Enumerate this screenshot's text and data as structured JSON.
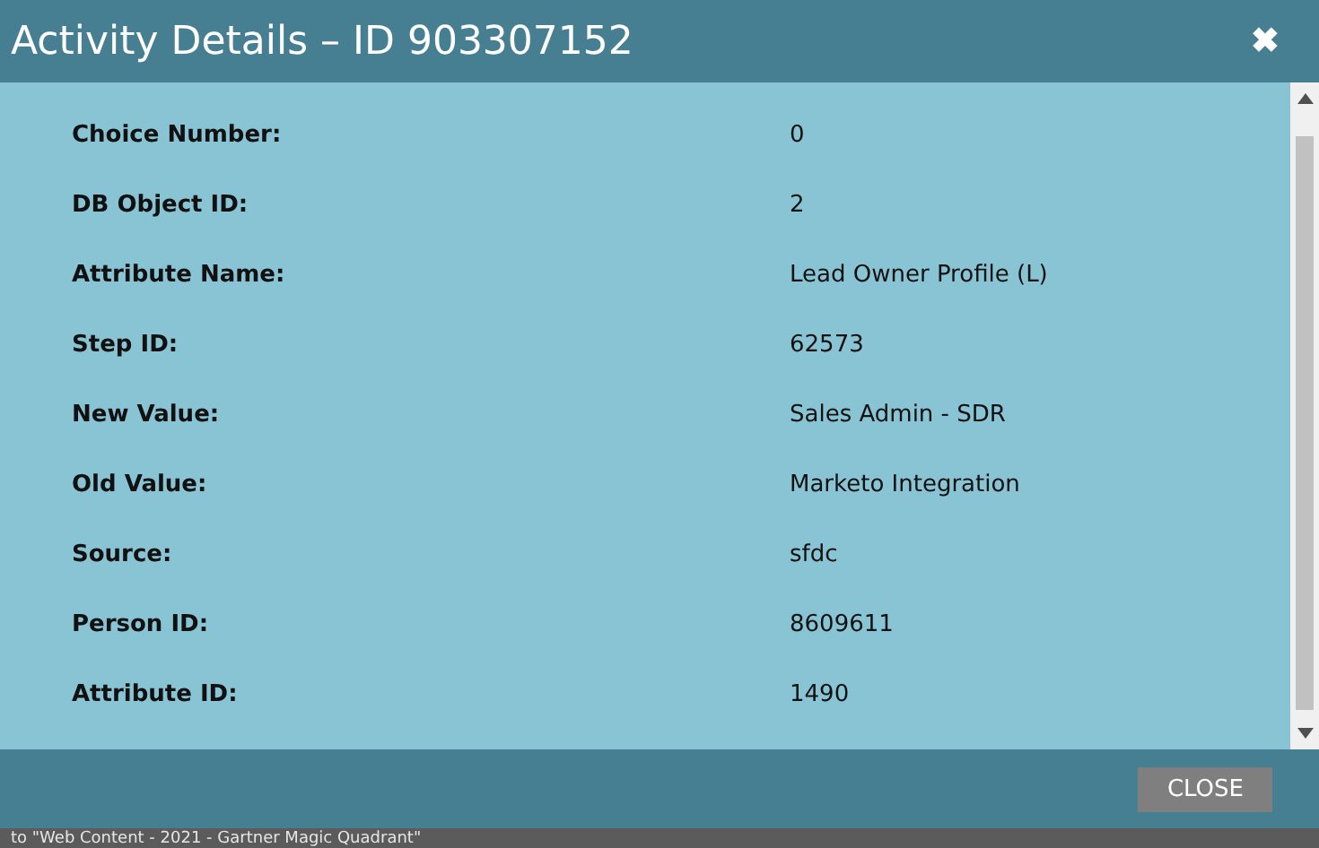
{
  "dialog": {
    "title": "Activity Details – ID 903307152",
    "close_icon": "✖",
    "fields": [
      {
        "label": "Choice Number:",
        "value": "0"
      },
      {
        "label": "DB Object ID:",
        "value": "2"
      },
      {
        "label": "Attribute Name:",
        "value": "Lead Owner Profile (L)"
      },
      {
        "label": "Step ID:",
        "value": "62573"
      },
      {
        "label": "New Value:",
        "value": "Sales Admin - SDR"
      },
      {
        "label": "Old Value:",
        "value": "Marketo Integration"
      },
      {
        "label": "Source:",
        "value": "sfdc"
      },
      {
        "label": "Person ID:",
        "value": "8609611"
      },
      {
        "label": "Attribute ID:",
        "value": "1490"
      }
    ],
    "close_button": "CLOSE"
  },
  "background_text": "to \"Web Content - 2021 - Gartner Magic Quadrant\""
}
